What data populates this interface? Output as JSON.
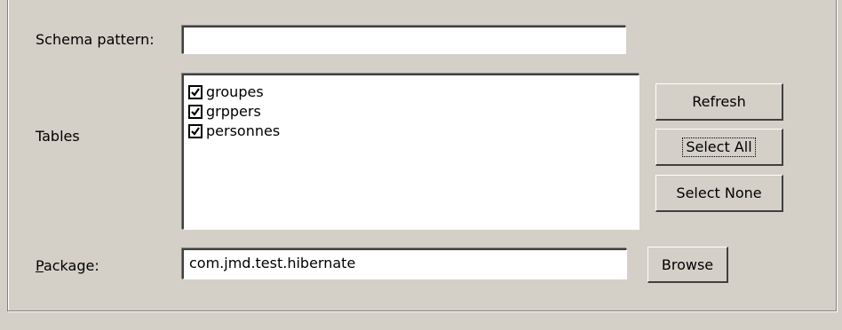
{
  "schema": {
    "label": "Schema pattern:",
    "value": "",
    "placeholder": ""
  },
  "tables": {
    "label": "Tables",
    "items": [
      {
        "name": "groupes",
        "checked": true
      },
      {
        "name": "grppers",
        "checked": true
      },
      {
        "name": "personnes",
        "checked": true
      }
    ],
    "refresh_label": "Refresh",
    "select_all_label": "Select All",
    "select_none_label": "Select None"
  },
  "package": {
    "label_mnemonic": "P",
    "label_rest": "ackage:",
    "value": "com.jmd.test.hibernate",
    "browse_label": "Browse"
  },
  "colors": {
    "window_bg": "#d4d0c8",
    "field_bg": "#ffffff"
  }
}
